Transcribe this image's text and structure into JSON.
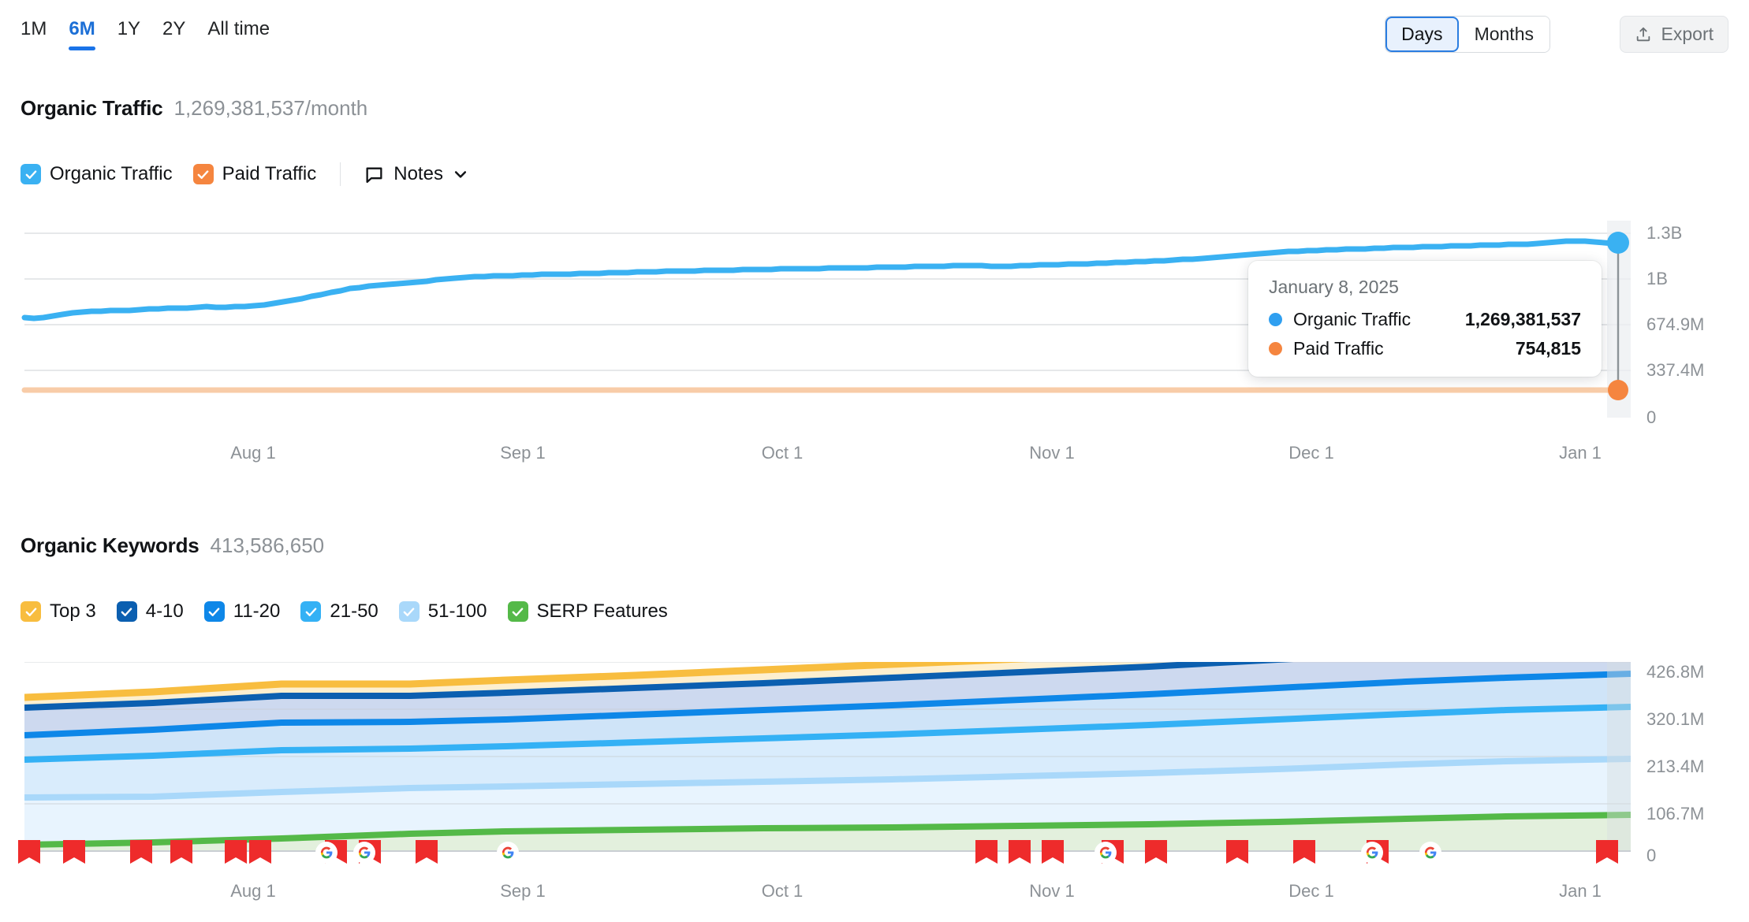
{
  "toolbar": {
    "ranges": [
      {
        "label": "1M",
        "active": false
      },
      {
        "label": "6M",
        "active": true
      },
      {
        "label": "1Y",
        "active": false
      },
      {
        "label": "2Y",
        "active": false
      },
      {
        "label": "All time",
        "active": false
      }
    ],
    "granularity": [
      {
        "label": "Days",
        "active": true
      },
      {
        "label": "Months",
        "active": false
      }
    ],
    "export_label": "Export"
  },
  "traffic": {
    "title": "Organic Traffic",
    "value": "1,269,381,537/month",
    "legend": [
      {
        "label": "Organic Traffic",
        "color": "#3ab1f2",
        "checked": true
      },
      {
        "label": "Paid Traffic",
        "color": "#f5853f",
        "checked": true
      }
    ],
    "notes_label": "Notes"
  },
  "tooltip": {
    "date": "January 8, 2025",
    "rows": [
      {
        "name": "Organic Traffic",
        "value": "1,269,381,537",
        "color": "#2f9ff0"
      },
      {
        "name": "Paid Traffic",
        "value": "754,815",
        "color": "#f5853f"
      }
    ]
  },
  "keywords": {
    "title": "Organic Keywords",
    "value": "413,586,650",
    "legend": [
      {
        "label": "Top 3",
        "color": "#f8bd3f",
        "checked": true
      },
      {
        "label": "4-10",
        "color": "#0b5fb0",
        "checked": true
      },
      {
        "label": "11-20",
        "color": "#0e87e8",
        "checked": true
      },
      {
        "label": "21-50",
        "color": "#34b1f5",
        "checked": true
      },
      {
        "label": "51-100",
        "color": "#a9d8fa",
        "checked": true
      },
      {
        "label": "SERP Features",
        "color": "#54b948",
        "checked": true
      }
    ]
  },
  "chart_data": [
    {
      "type": "line",
      "title": "Organic Traffic",
      "xlabel": "",
      "ylabel": "",
      "grid": true,
      "legend_position": "top",
      "x_ticks": [
        "Aug 1",
        "Sep 1",
        "Oct 1",
        "Nov 1",
        "Dec 1",
        "Jan 1"
      ],
      "y_ticks": [
        "1.3B",
        "1B",
        "674.9M",
        "337.4M",
        "0"
      ],
      "y_tick_values": [
        1300000000,
        1000000000,
        674900000,
        337400000,
        0
      ],
      "ylim": [
        0,
        1349800000
      ],
      "series": [
        {
          "name": "Organic Traffic",
          "color": "#3ab1f2",
          "values": [
            620000000,
            618000000,
            622000000,
            631000000,
            645000000,
            652000000,
            662000000,
            668000000,
            671000000,
            673000000,
            674000000,
            676000000,
            682000000,
            685000000,
            690000000,
            694000000,
            691000000,
            695000000,
            700000000,
            705000000,
            703000000,
            699000000,
            704000000,
            710000000,
            716000000,
            722000000,
            730000000,
            742000000,
            756000000,
            772000000,
            790000000,
            808000000,
            826000000,
            845000000,
            862000000,
            875000000,
            884000000,
            892000000,
            898000000,
            904000000,
            910000000,
            918000000,
            928000000,
            940000000,
            952000000,
            961000000,
            967000000,
            972000000,
            975000000,
            978000000,
            982000000,
            985000000,
            988000000,
            992000000,
            995000000,
            996000000,
            998000000,
            1000000000,
            1002000000,
            1004000000,
            1006000000,
            1008000000,
            1010000000,
            1011000000,
            1013000000,
            1015000000,
            1017000000,
            1019000000,
            1021000000,
            1022000000,
            1023000000,
            1024000000,
            1026000000,
            1028000000,
            1030000000,
            1031000000,
            1033000000,
            1035000000,
            1036000000,
            1038000000,
            1040000000,
            1041000000,
            1042000000,
            1043000000,
            1045000000,
            1046000000,
            1048000000,
            1050000000,
            1051000000,
            1052000000,
            1054000000,
            1056000000,
            1058000000,
            1060000000,
            1062000000,
            1064000000,
            1066000000,
            1068000000,
            1070000000,
            1072000000,
            1073000000,
            1071000000,
            1070000000,
            1072000000,
            1075000000,
            1078000000,
            1080000000,
            1083000000,
            1085000000,
            1087000000,
            1090000000,
            1093000000,
            1096000000,
            1099000000,
            1102000000,
            1106000000,
            1110000000,
            1114000000,
            1118000000,
            1123000000,
            1128000000,
            1134000000,
            1140000000,
            1147000000,
            1155000000,
            1163000000,
            1172000000,
            1180000000,
            1187000000,
            1193000000,
            1198000000,
            1203000000,
            1207000000,
            1210000000,
            1213000000,
            1216000000,
            1219000000,
            1221000000,
            1224000000,
            1227000000,
            1230000000,
            1233000000,
            1235000000,
            1236000000,
            1238000000,
            1240000000,
            1243000000,
            1246000000,
            1249000000,
            1252000000,
            1254000000,
            1256000000,
            1258000000,
            1260000000,
            1262000000,
            1265000000,
            1268000000,
            1272000000,
            1276000000,
            1279000000,
            1281000000,
            1280000000,
            1278000000,
            1275000000,
            1272000000,
            1269381537
          ]
        },
        {
          "name": "Paid Traffic",
          "color": "#f5853f",
          "constant_value": 754815,
          "values": []
        }
      ],
      "hover": {
        "date": "January 8, 2025",
        "organic": 1269381537,
        "paid": 754815
      }
    },
    {
      "type": "area",
      "title": "Organic Keywords",
      "stacked": true,
      "xlabel": "",
      "ylabel": "",
      "grid": true,
      "legend_position": "top",
      "x_ticks": [
        "Aug 1",
        "Sep 1",
        "Oct 1",
        "Nov 1",
        "Dec 1",
        "Jan 1"
      ],
      "y_ticks": [
        "426.8M",
        "320.1M",
        "213.4M",
        "106.7M",
        "0"
      ],
      "y_tick_values": [
        426800000,
        320100000,
        213400000,
        106700000,
        0
      ],
      "ylim": [
        0,
        426800000
      ],
      "x_fractions": [
        0,
        0.08,
        0.16,
        0.24,
        0.3,
        0.38,
        0.46,
        0.54,
        0.62,
        0.7,
        0.78,
        0.86,
        0.93,
        1
      ],
      "series": [
        {
          "name": "SERP Features",
          "color": "#54b948",
          "fill": "#e3f0dd",
          "values": [
            3000000,
            5000000,
            9000000,
            14000000,
            17000000,
            19000000,
            20000000,
            21000000,
            22000000,
            23000000,
            25000000,
            28000000,
            30000000,
            31000000
          ]
        },
        {
          "name": "51-100",
          "color": "#a9d8fa",
          "fill": "#e8f4fe",
          "values": [
            86000000,
            86000000,
            87000000,
            89000000,
            92000000,
            95000000,
            99000000,
            103000000,
            107000000,
            112000000,
            117000000,
            121000000,
            124000000,
            126000000
          ]
        },
        {
          "name": "21-50",
          "color": "#34b1f5",
          "fill": "#d9ecfc",
          "values": [
            84000000,
            88000000,
            94000000,
            92000000,
            90000000,
            94000000,
            98000000,
            101000000,
            104000000,
            108000000,
            112000000,
            115000000,
            117000000,
            117000000
          ]
        },
        {
          "name": "11-20",
          "color": "#0e87e8",
          "fill": "#cfe4f8",
          "values": [
            55000000,
            58000000,
            62000000,
            60000000,
            59000000,
            62000000,
            64000000,
            66000000,
            68000000,
            70000000,
            72000000,
            74000000,
            75000000,
            75000000
          ]
        },
        {
          "name": "4-10",
          "color": "#0b5fb0",
          "fill": "#cdd9ef",
          "values": [
            62000000,
            65000000,
            70000000,
            68000000,
            66000000,
            69000000,
            72000000,
            74000000,
            76000000,
            79000000,
            82000000,
            84000000,
            85000000,
            85000000
          ]
        },
        {
          "name": "Top 3",
          "color": "#f8bd3f",
          "fill": "#fdefcf",
          "values": [
            19000000,
            20000000,
            21000000,
            21000000,
            21000000,
            22000000,
            23000000,
            23000000,
            24000000,
            25000000,
            26000000,
            27000000,
            27000000,
            27000000
          ]
        }
      ],
      "event_markers": {
        "flag_color": "#ee2b2b",
        "positions_flag": [
          0.004,
          0.032,
          0.074,
          0.099,
          0.133,
          0.148,
          0.196,
          0.217,
          0.253,
          0.588,
          0.608,
          0.628,
          0.666,
          0.692,
          0.743,
          0.787,
          0.833,
          0.987
        ],
        "positions_google": [
          0.175,
          0.208,
          0.268,
          0.66,
          0.828,
          0.861
        ]
      }
    }
  ]
}
